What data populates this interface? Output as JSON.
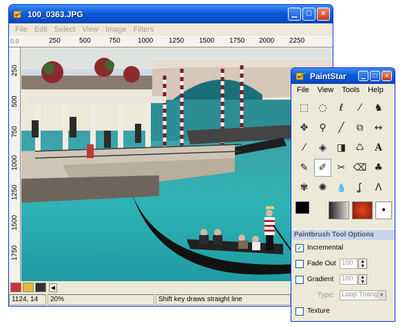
{
  "image_window": {
    "title": "100_0363.JPG",
    "menu": [
      "File",
      "Edit",
      "Select",
      "View",
      "Image",
      "Filters"
    ],
    "ruler_origin": "0.0",
    "ruler_h_ticks": [
      "250",
      "500",
      "750",
      "1000",
      "1250",
      "1500",
      "1750",
      "2000",
      "2250"
    ],
    "ruler_v_ticks": [
      "250",
      "500",
      "750",
      "1000",
      "1250",
      "1500",
      "1750"
    ],
    "status": {
      "coords": "1124, 14",
      "zoom": "20%",
      "hint": "Shift key draws straight line"
    }
  },
  "toolbox": {
    "title": "PaintStar",
    "menu": [
      "File",
      "View",
      "Tools",
      "Help"
    ],
    "tools": [
      {
        "name": "rect-select",
        "glyph": "⬚"
      },
      {
        "name": "ellipse-select",
        "glyph": "◌"
      },
      {
        "name": "lasso",
        "glyph": "ℓ"
      },
      {
        "name": "magic-wand",
        "glyph": "⁄"
      },
      {
        "name": "path",
        "glyph": "♞"
      },
      {
        "name": "move",
        "glyph": "✥"
      },
      {
        "name": "zoom",
        "glyph": "⚲"
      },
      {
        "name": "pencil-line",
        "glyph": "╱"
      },
      {
        "name": "copy",
        "glyph": "⧉"
      },
      {
        "name": "flip",
        "glyph": "↔"
      },
      {
        "name": "color-picker",
        "glyph": "⁄"
      },
      {
        "name": "fill",
        "glyph": "◈"
      },
      {
        "name": "gradient",
        "glyph": "◨"
      },
      {
        "name": "clone",
        "glyph": "♺"
      },
      {
        "name": "text",
        "glyph": "A"
      },
      {
        "name": "pencil",
        "glyph": "✎"
      },
      {
        "name": "paintbrush",
        "glyph": "✐"
      },
      {
        "name": "airbrush",
        "glyph": "✂"
      },
      {
        "name": "eraser",
        "glyph": "⌫"
      },
      {
        "name": "stamp",
        "glyph": "♣"
      },
      {
        "name": "smudge",
        "glyph": "✾"
      },
      {
        "name": "palette",
        "glyph": "✺"
      },
      {
        "name": "blur",
        "glyph": "💧"
      },
      {
        "name": "sharpen",
        "glyph": "ʆ"
      },
      {
        "name": "measure",
        "glyph": "Λ"
      }
    ],
    "colors": {
      "foreground": "#000000",
      "background": "#ffffff"
    },
    "options": {
      "header": "Paintbrush Tool Options",
      "incremental_label": "Incremental",
      "incremental_checked": true,
      "fade_label": "Fade Out",
      "fade_value": "100",
      "gradient_label": "Gradient",
      "gradient_value": "100",
      "type_label": "Type:",
      "type_value": "Loop Triangle",
      "texture_label": "Texture"
    }
  }
}
